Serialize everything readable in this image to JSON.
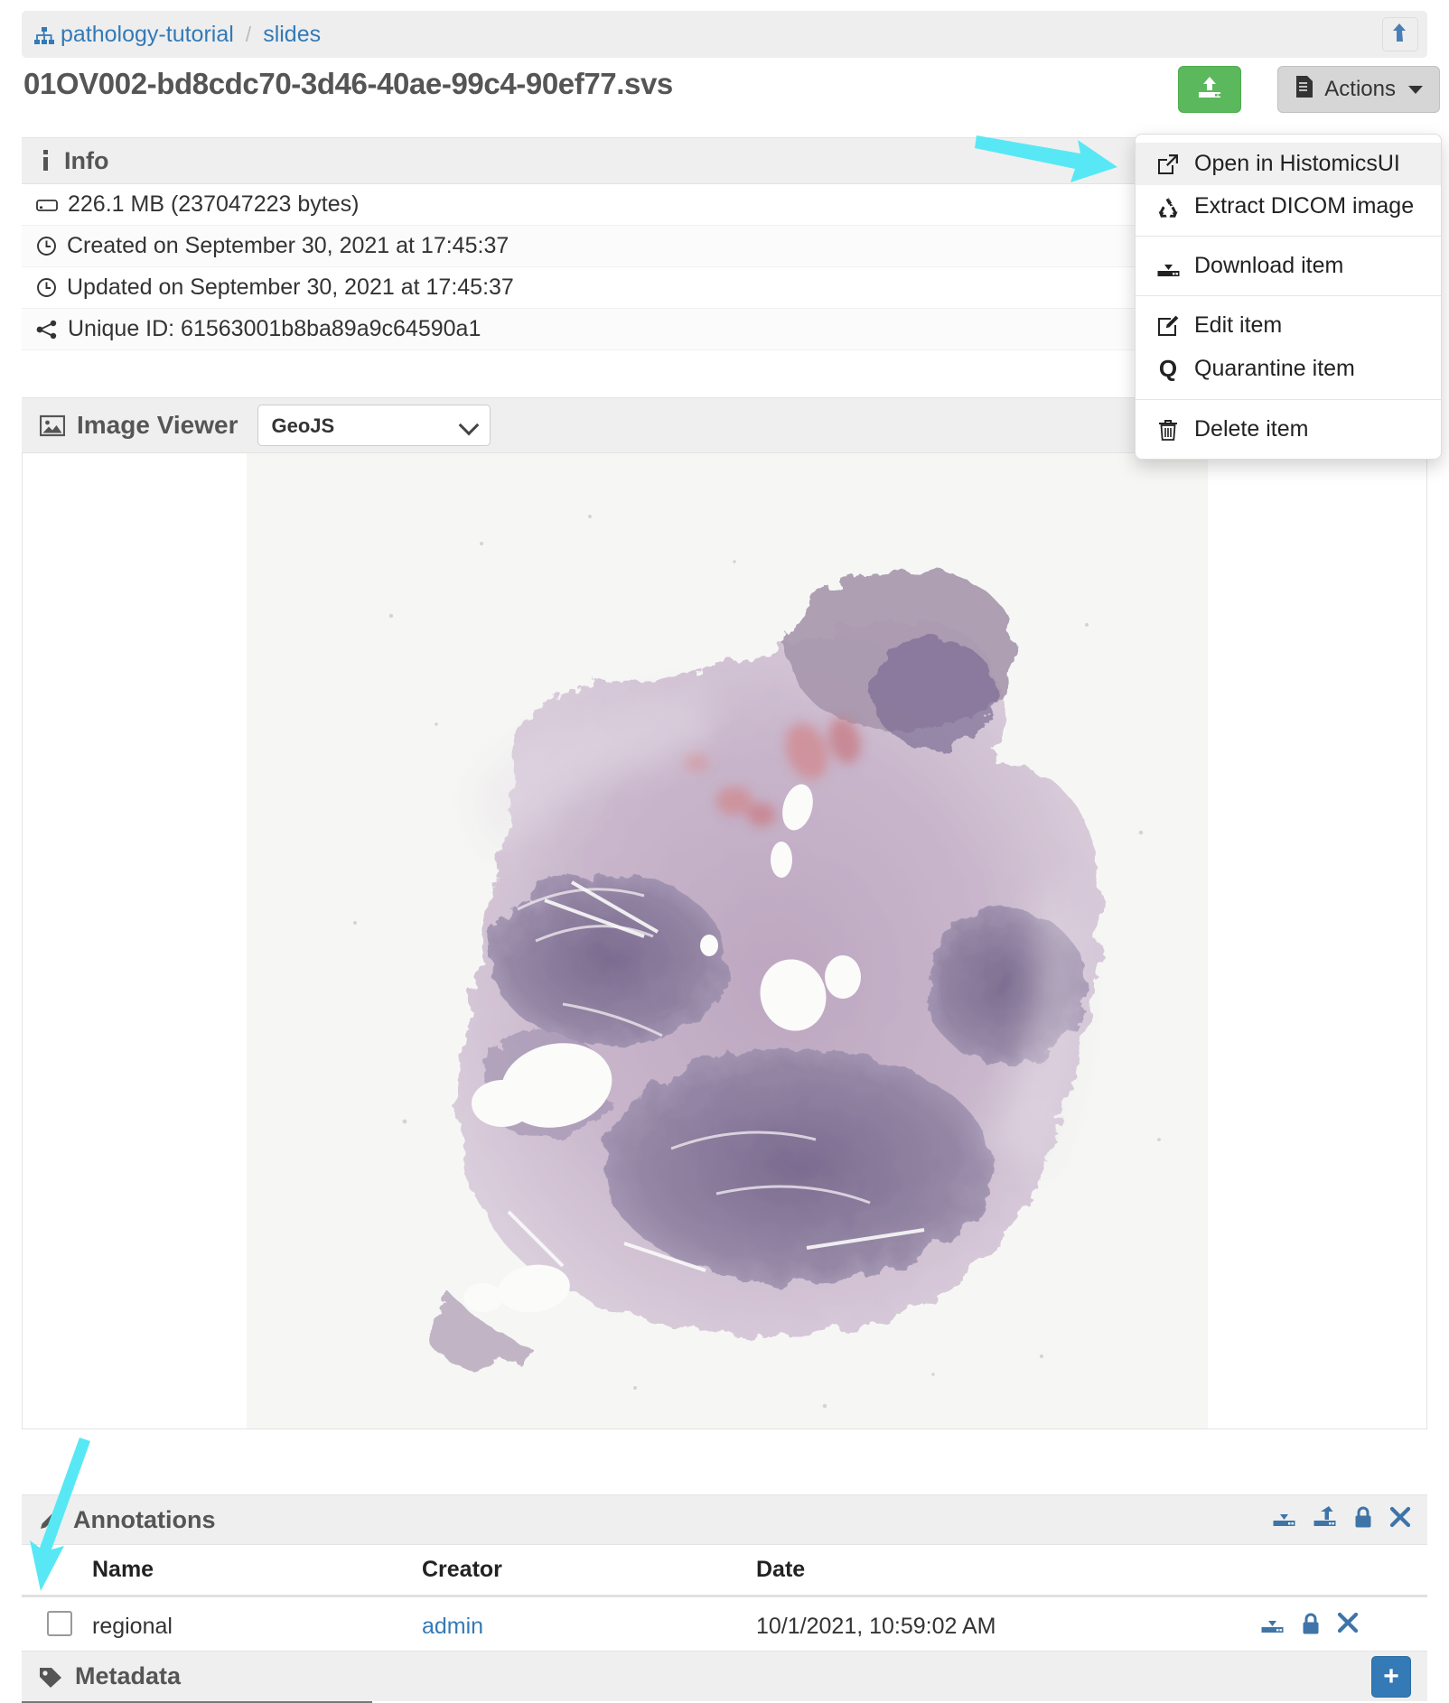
{
  "breadcrumb": {
    "root_icon": "sitemap-icon",
    "items": [
      {
        "label": "pathology-tutorial"
      },
      {
        "label": "slides"
      }
    ],
    "separator": "/",
    "level_up_icon": "level-up-icon"
  },
  "header": {
    "title": "01OV002-bd8cdc70-3d46-40ae-99c4-90ef77.svs",
    "upload_icon": "upload-icon",
    "actions_label": "Actions",
    "actions_icon": "file-icon",
    "actions_caret": "caret-down-icon",
    "accent_green": "#5cb85c",
    "accent_blue": "#337ab7"
  },
  "actions_menu": {
    "groups": [
      {
        "items": [
          {
            "label": "Open in HistomicsUI",
            "icon": "external-link-icon",
            "active": true
          },
          {
            "label": "Extract DICOM image",
            "icon": "recycle-icon",
            "active": false
          }
        ]
      },
      {
        "items": [
          {
            "label": "Download item",
            "icon": "download-icon",
            "active": false
          }
        ]
      },
      {
        "items": [
          {
            "label": "Edit item",
            "icon": "edit-icon",
            "active": false
          },
          {
            "label": "Quarantine item",
            "icon": "quarantine-q-icon",
            "active": false
          }
        ]
      },
      {
        "items": [
          {
            "label": "Delete item",
            "icon": "trash-icon",
            "active": false
          }
        ]
      }
    ]
  },
  "info": {
    "heading": "Info",
    "heading_icon": "info-icon",
    "rows": [
      {
        "icon": "hdd-icon",
        "text": "226.1 MB (237047223 bytes)"
      },
      {
        "icon": "clock-icon",
        "text": "Created on September 30, 2021 at 17:45:37"
      },
      {
        "icon": "clock-icon",
        "text": "Updated on September 30, 2021 at 17:45:37"
      },
      {
        "icon": "share-icon",
        "text": "Unique ID: 61563001b8ba89a9c64590a1"
      }
    ]
  },
  "image_viewer": {
    "heading": "Image Viewer",
    "heading_icon": "picture-icon",
    "selected_viewer": "GeoJS",
    "options": [
      "GeoJS"
    ],
    "slide_alt": "whole-slide-pathology-image"
  },
  "annotations": {
    "heading": "Annotations",
    "heading_icon": "pencil-icon",
    "header_actions": [
      {
        "icon": "download-icon"
      },
      {
        "icon": "upload-icon"
      },
      {
        "icon": "lock-icon"
      },
      {
        "icon": "close-x-icon"
      }
    ],
    "columns": [
      "Name",
      "Creator",
      "Date"
    ],
    "rows": [
      {
        "checked": false,
        "name": "regional",
        "creator": "admin",
        "date": "10/1/2021, 10:59:02 AM",
        "actions": [
          {
            "icon": "download-icon"
          },
          {
            "icon": "lock-icon"
          },
          {
            "icon": "close-x-icon"
          }
        ]
      }
    ]
  },
  "metadata": {
    "heading": "Metadata",
    "heading_icon": "tag-icon",
    "add_label": "+"
  },
  "annotations_overlay": {
    "arrow_color": "#58e8f5",
    "arrow_1_target": "Open in HistomicsUI",
    "arrow_2_target": "annotation-row-checkbox"
  }
}
